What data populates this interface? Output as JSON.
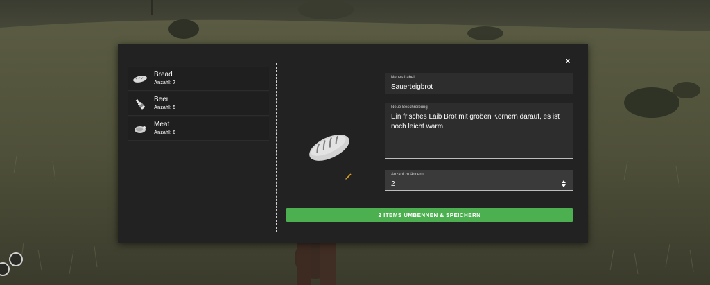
{
  "modal": {
    "close_label": "x",
    "items": [
      {
        "name": "Bread",
        "count": "Anzahl: 7",
        "icon": "bread-icon"
      },
      {
        "name": "Beer",
        "count": "Anzahl: 5",
        "icon": "beer-bottle-icon"
      },
      {
        "name": "Meat",
        "count": "Anzahl: 8",
        "icon": "meat-icon"
      }
    ],
    "preview_icon": "bread-icon",
    "edit_icon": "pencil-icon",
    "label_field": {
      "label": "Neues Label",
      "value": "Sauerteigbrot"
    },
    "description_field": {
      "label": "Neue Beschreibung",
      "value": "Ein frisches Laib Brot mit groben Körnern darauf, es ist noch leicht warm."
    },
    "quantity_field": {
      "label": "Anzahl zu ändern",
      "value": "2"
    },
    "save_button": "2 ITEMS UMBENNEN & SPEICHERN"
  },
  "colors": {
    "modal_bg": "#222222",
    "accent_green": "#4caf50",
    "field_bg": "#2d2d2d"
  }
}
